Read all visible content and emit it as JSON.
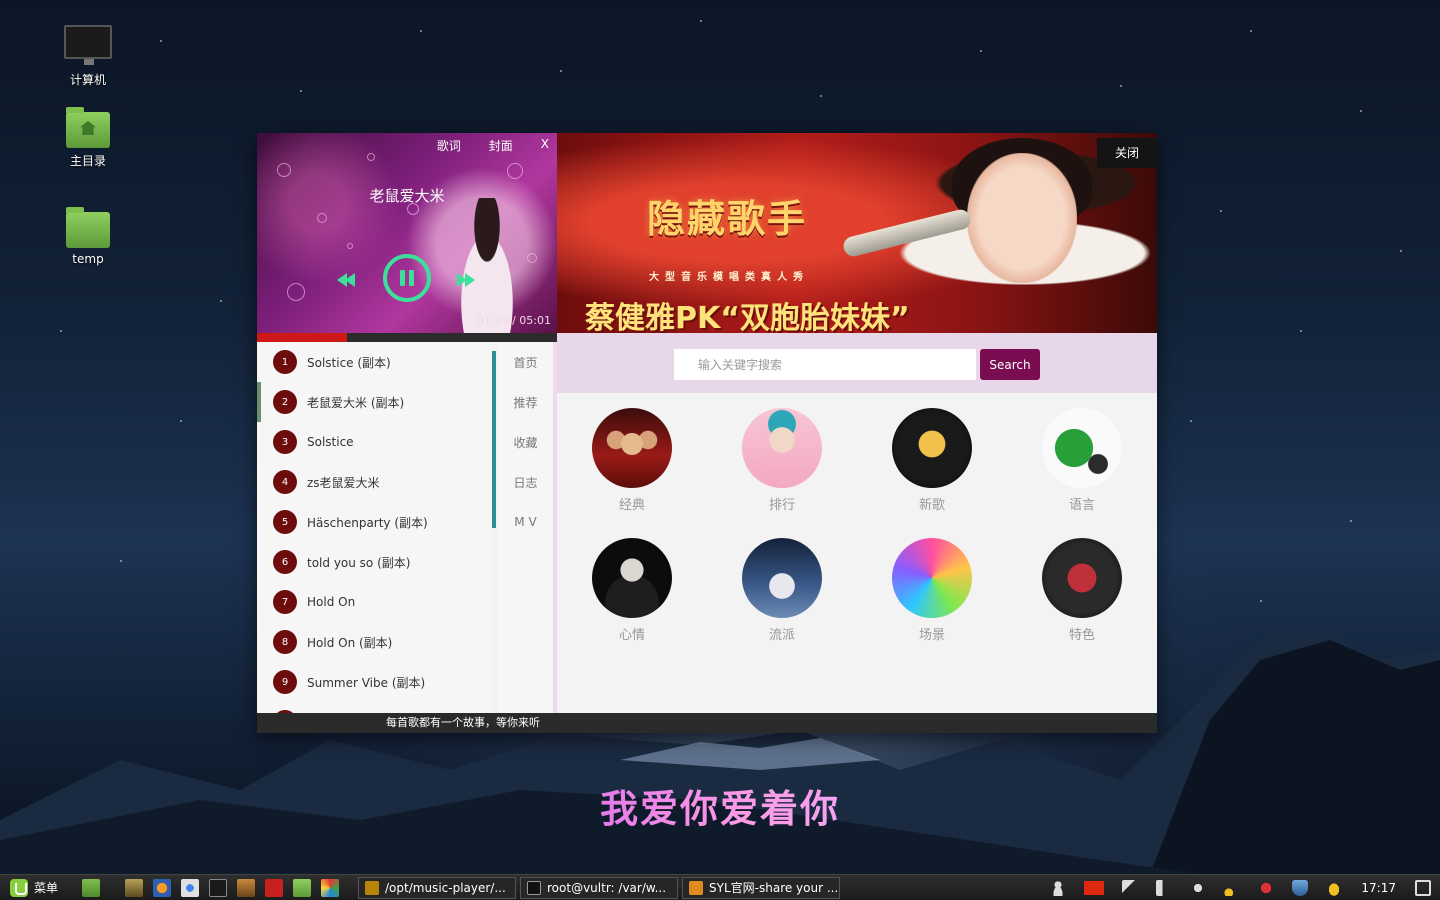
{
  "desktop": {
    "icons": [
      {
        "label": "计算机"
      },
      {
        "label": "主目录"
      },
      {
        "label": "temp"
      }
    ]
  },
  "player": {
    "top_links": [
      "歌词",
      "封面",
      "X"
    ],
    "song_title": "老鼠爱大米",
    "time": "01:29 / 05:01",
    "progress": 0.3,
    "accent_color": "#3de09a",
    "progress_color": "#d11818"
  },
  "banner": {
    "logo_text": "隐藏歌手",
    "subtitle": "大型音乐模唱类真人秀",
    "headline": "蔡健雅PK“双胞胎妹妹”",
    "close_label": "关闭"
  },
  "playlist": {
    "items": [
      {
        "num": "1",
        "title": "Solstice (副本)"
      },
      {
        "num": "2",
        "title": "老鼠爱大米 (副本)",
        "active": true
      },
      {
        "num": "3",
        "title": "Solstice"
      },
      {
        "num": "4",
        "title": "zs老鼠爱大米"
      },
      {
        "num": "5",
        "title": "Häschenparty (副本)"
      },
      {
        "num": "6",
        "title": "told you so (副本)"
      },
      {
        "num": "7",
        "title": "Hold On"
      },
      {
        "num": "8",
        "title": "Hold On (副本)"
      },
      {
        "num": "9",
        "title": "Summer Vibe (副本)"
      }
    ]
  },
  "sidenav": {
    "items": [
      "首页",
      "推荐",
      "收藏",
      "日志",
      "M V"
    ]
  },
  "search": {
    "placeholder": "输入关键字搜索",
    "button_label": "Search"
  },
  "categories": {
    "items": [
      "经典",
      "排行",
      "新歌",
      "语言",
      "心情",
      "流派",
      "场景",
      "特色"
    ]
  },
  "footer": {
    "text": "每首歌都有一个故事，等你来听"
  },
  "lyric": {
    "text": "我爱你爱着你"
  },
  "taskbar": {
    "menu_label": "菜单",
    "windows": [
      {
        "label": "/opt/music-player/..."
      },
      {
        "label": "root@vultr: /var/w..."
      },
      {
        "label": "SYL官网-share your ..."
      }
    ],
    "clock": "17:17"
  }
}
